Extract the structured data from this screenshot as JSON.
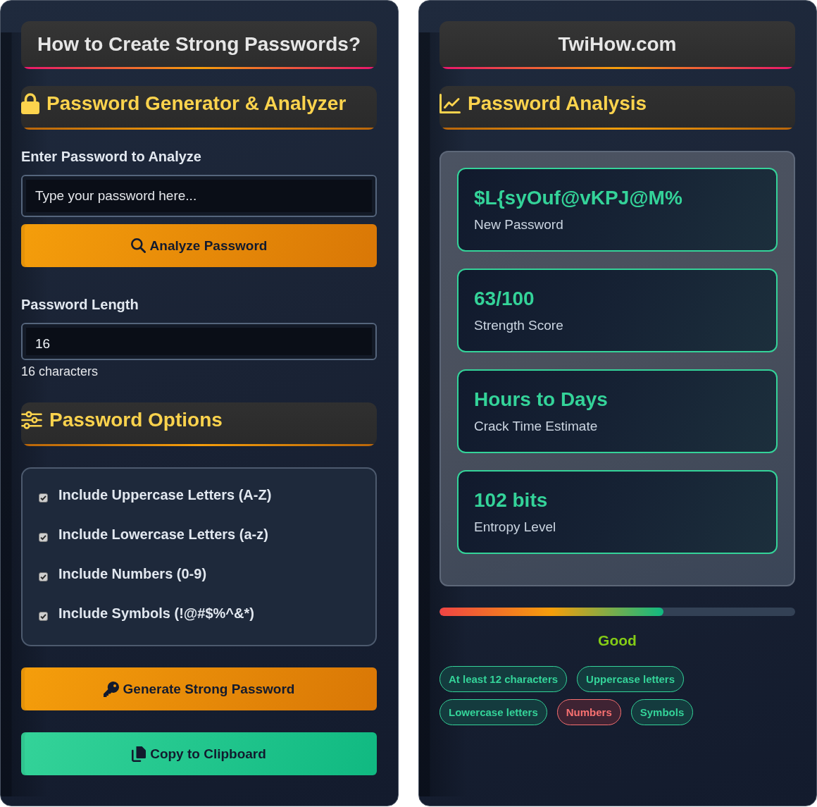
{
  "left_panel": {
    "title": "How to Create Strong Passwords?",
    "generator_heading": "Password Generator & Analyzer",
    "password_field": {
      "label": "Enter Password to Analyze",
      "placeholder": "Type your password here..."
    },
    "analyze_button": "Analyze Password",
    "length_field": {
      "label": "Password Length",
      "value": "16",
      "hint": "16 characters"
    },
    "options_heading": "Password Options",
    "options": [
      {
        "label": "Include Uppercase Letters (A-Z)",
        "checked": true
      },
      {
        "label": "Include Lowercase Letters (a-z)",
        "checked": true
      },
      {
        "label": "Include Numbers (0-9)",
        "checked": true
      },
      {
        "label": "Include Symbols (!@#$%^&*)",
        "checked": true
      }
    ],
    "generate_button": "Generate Strong Password",
    "copy_button": "Copy to Clipboard"
  },
  "right_panel": {
    "title": "TwiHow.com",
    "analysis_heading": "Password Analysis",
    "results": [
      {
        "value": "$L{syOuf@vKPJ@M%",
        "label": "New Password"
      },
      {
        "value": "63/100",
        "label": "Strength Score"
      },
      {
        "value": "Hours to Days",
        "label": "Crack Time Estimate"
      },
      {
        "value": "102 bits",
        "label": "Entropy Level"
      }
    ],
    "strength_meter": {
      "level": 0.63
    },
    "strength_label": "Good",
    "requirements": [
      {
        "label": "At least 12 characters",
        "met": true
      },
      {
        "label": "Uppercase letters",
        "met": true
      },
      {
        "label": "Lowercase letters",
        "met": true
      },
      {
        "label": "Numbers",
        "met": false
      },
      {
        "label": "Symbols",
        "met": true
      }
    ]
  }
}
